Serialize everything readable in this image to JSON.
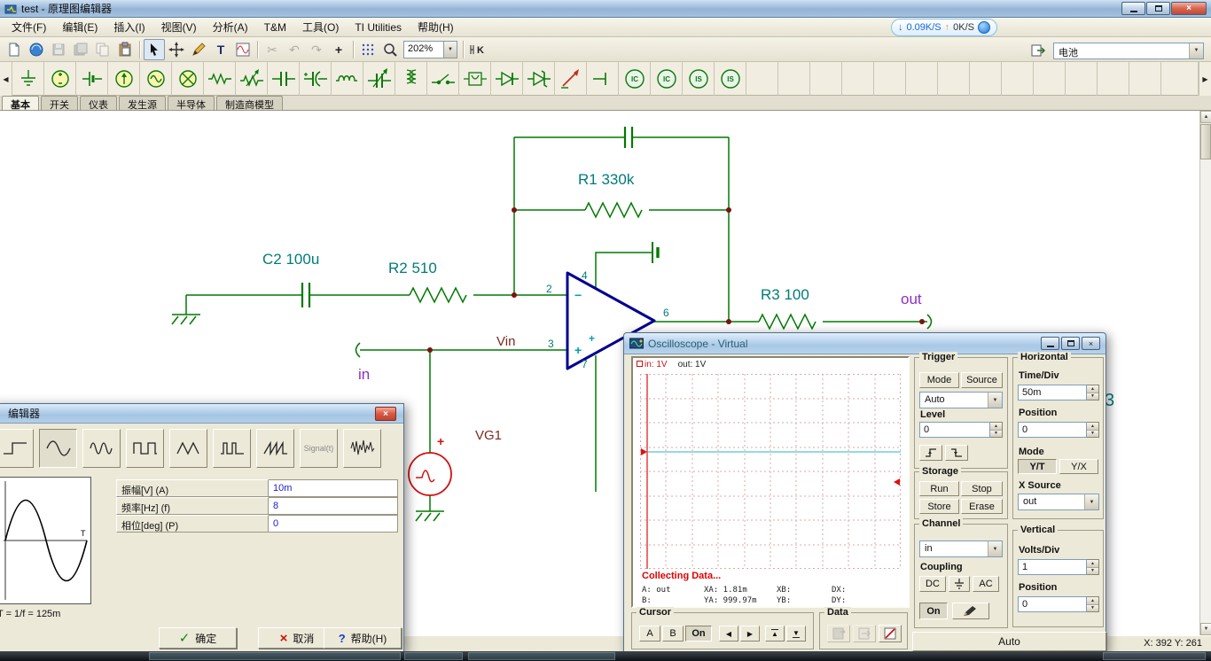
{
  "window": {
    "title": "test - 原理图编辑器"
  },
  "menubar": {
    "items": [
      "文件(F)",
      "编辑(E)",
      "插入(I)",
      "视图(V)",
      "分析(A)",
      "T&M",
      "工具(O)",
      "TI Utilities",
      "帮助(H)"
    ],
    "net_monitor": {
      "down_speed": "0.09K/S",
      "up_speed": "0K/S"
    }
  },
  "toolbar": {
    "zoom": "202%",
    "part_dropdown": "电池",
    "icons": [
      "new-file",
      "open",
      "save",
      "save-as",
      "copy",
      "paste",
      "select-cursor",
      "move-tool",
      "pencil",
      "text-tool",
      "waveform-viewer",
      "cut",
      "undo",
      "redo",
      "add-part",
      "grid-toggle",
      "zoom-lens",
      "macro-chip",
      "export-netlist"
    ]
  },
  "component_toolbar": {
    "icons": [
      "ground",
      "dc-voltage-source",
      "battery",
      "current-source",
      "ac-voltage-source",
      "lamp",
      "resistor",
      "potentiometer",
      "capacitor",
      "electrolytic-capacitor",
      "inductor",
      "variable-capacitor",
      "transformer",
      "switch",
      "relay",
      "diode",
      "zener-diode",
      "probe",
      "open-terminal",
      "ic-round-1",
      "ic-round-2",
      "is-round-1",
      "is-round-2"
    ]
  },
  "component_tabs": [
    "基本",
    "开关",
    "仪表",
    "发生源",
    "半导体",
    "制造商模型"
  ],
  "schematic": {
    "r1_label": "R1 330k",
    "c2_label": "C2 100u",
    "r2_label": "R2 510",
    "r3_label": "R3 100",
    "out_label": "out",
    "in_label": "in",
    "vin_label": "Vin",
    "vg1_label": "VG1",
    "pin2": "2",
    "pin3": "3",
    "pin4": "4",
    "pin6": "6",
    "pin7": "7",
    "edge_label": "3",
    "colors": {
      "wire": "#007A00",
      "opamp": "#000090",
      "value_label": "#007B7B",
      "net_label": "#8B2FC9",
      "refdes_label": "#7B2A1E",
      "junction": "#7A1212"
    }
  },
  "editor_dialog": {
    "title": "编辑器",
    "signal_button": "Signal(t)",
    "period_caption": "T = 1/f = 125m",
    "params": {
      "amplitude_label": "振幅[V]  (A)",
      "amplitude_value": "10m",
      "frequency_label": "频率[Hz]  (f)",
      "frequency_value": "8",
      "phase_label": "相位[deg]  (P)",
      "phase_value": "0"
    },
    "ok_button": "确定",
    "cancel_button": "取消",
    "help_button": "帮助(H)"
  },
  "oscilloscope": {
    "title": "Oscilloscope - Virtual",
    "screen": {
      "ch_in_label": "in: 1V",
      "ch_out_label": "out: 1V",
      "status": "Collecting Data...",
      "readout_a": "A: out",
      "readout_xa": "XA: 1.81m",
      "readout_xb": "XB:",
      "readout_dx": "DX:",
      "readout_b": "B:",
      "readout_ya": "YA: 999.97m",
      "readout_yb": "YB:",
      "readout_dy": "DY:"
    },
    "trigger": {
      "legend": "Trigger",
      "mode_button": "Mode",
      "source_button": "Source",
      "mode_value": "Auto",
      "level_label": "Level",
      "level_value": "0"
    },
    "horizontal": {
      "legend": "Horizontal",
      "time_div_label": "Time/Div",
      "time_div_value": "50m",
      "position_label": "Position",
      "position_value": "0",
      "mode_label": "Mode",
      "yt_button": "Y/T",
      "yx_button": "Y/X",
      "x_source_label": "X Source",
      "x_source_value": "out"
    },
    "storage": {
      "legend": "Storage",
      "run_button": "Run",
      "stop_button": "Stop",
      "store_button": "Store",
      "erase_button": "Erase"
    },
    "channel": {
      "legend": "Channel",
      "channel_value": "in",
      "coupling_label": "Coupling",
      "dc_button": "DC",
      "ac_button": "AC",
      "on_button": "On"
    },
    "vertical": {
      "legend": "Vertical",
      "volts_div_label": "Volts/Div",
      "volts_div_value": "1",
      "position_label": "Position",
      "position_value": "0"
    },
    "cursor": {
      "legend": "Cursor",
      "a_button": "A",
      "b_button": "B",
      "on_button": "On"
    },
    "data": {
      "legend": "Data"
    },
    "auto_button": "Auto"
  },
  "statusbar": {
    "coords": "X: 392  Y: 261"
  }
}
